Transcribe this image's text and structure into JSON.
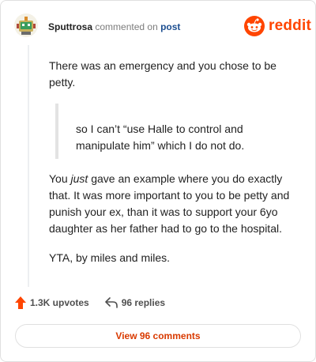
{
  "comment": {
    "author": "Sputtrosa",
    "action_text": "commented on",
    "post_link": "post",
    "logo_text": "reddit",
    "paragraph1": "There was an emergency and you chose to be petty.",
    "quote": "so I can’t “use Halle to control and manipulate him” which I do not do.",
    "paragraph2_before": "You ",
    "paragraph2_em": "just",
    "paragraph2_after": " gave an example where you do exactly that. It was more important to you to be petty and punish your ex, than it was to support your 6yo daughter as her father had to go to the hospital.",
    "paragraph3": "YTA, by miles and miles."
  },
  "actions": {
    "upvotes": "1.3K upvotes",
    "replies": "96 replies"
  },
  "view_button": "View 96 comments",
  "colors": {
    "brand": "#ff4500",
    "post_link": "#1d4f91",
    "view_button_text": "#d93a00"
  },
  "icons": {
    "avatar": "robot-avatar-icon",
    "logo": "reddit-logo-icon",
    "upvote": "upvote-arrow-icon",
    "reply": "reply-arrow-icon"
  }
}
